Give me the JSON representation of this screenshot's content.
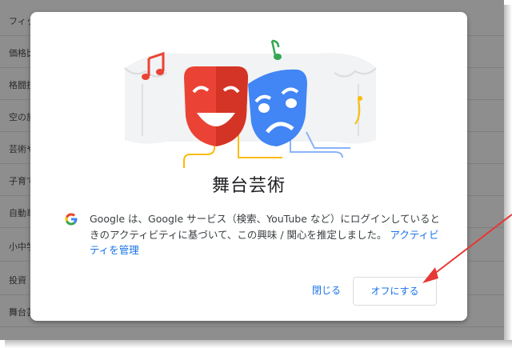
{
  "background": {
    "rows": [
      {
        "label": "フィッ"
      },
      {
        "label": "価格比"
      },
      {
        "label": "格闘技"
      },
      {
        "label": "空の旅"
      },
      {
        "label": "芸術や"
      },
      {
        "label": "子育て"
      },
      {
        "label": "自動車"
      },
      {
        "label": "小中学"
      },
      {
        "label": "投資"
      },
      {
        "label": "舞台芸"
      }
    ]
  },
  "dialog": {
    "title": "舞台芸術",
    "info_text": "Google は、Google サービス（検索、YouTube など）にログインしているときのアクティビティに基づいて、この興味 / 関心を推定しました。",
    "manage_link": "アクティビティを管理",
    "close_button": "閉じる",
    "turn_off_button": "オフにする"
  },
  "colors": {
    "accent": "#1a73e8",
    "comedy_mask": "#ea4335",
    "tragedy_mask": "#4285f4",
    "music_note_red": "#ea4335",
    "music_note_green": "#34a853",
    "annotation_arrow": "#e53935"
  },
  "icons": {
    "google_logo": "google-g-logo-icon",
    "comedy_mask": "comedy-mask-icon",
    "tragedy_mask": "tragedy-mask-icon"
  }
}
